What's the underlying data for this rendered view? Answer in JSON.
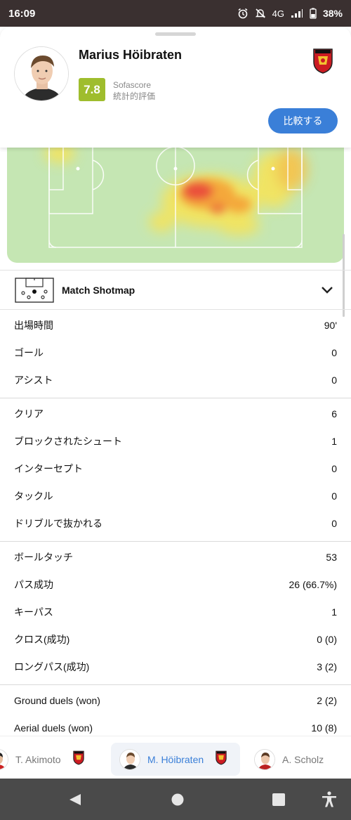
{
  "status_bar": {
    "time": "16:09",
    "network": "4G",
    "battery": "38%"
  },
  "header": {
    "player_name": "Marius Höibraten",
    "rating": "7.8",
    "rating_source": "Sofascore",
    "rating_subtitle": "統計的評価",
    "compare_button": "比較する"
  },
  "shotmap": {
    "title": "Match Shotmap"
  },
  "stat_groups": [
    [
      {
        "label": "出場時間",
        "value": "90'"
      },
      {
        "label": "ゴール",
        "value": "0"
      },
      {
        "label": "アシスト",
        "value": "0"
      }
    ],
    [
      {
        "label": "クリア",
        "value": "6"
      },
      {
        "label": "ブロックされたシュート",
        "value": "1"
      },
      {
        "label": "インターセプト",
        "value": "0"
      },
      {
        "label": "タックル",
        "value": "0"
      },
      {
        "label": "ドリブルで抜かれる",
        "value": "0"
      }
    ],
    [
      {
        "label": "ボールタッチ",
        "value": "53"
      },
      {
        "label": "パス成功",
        "value": "26 (66.7%)"
      },
      {
        "label": "キーパス",
        "value": "1"
      },
      {
        "label": "クロス(成功)",
        "value": "0 (0)"
      },
      {
        "label": "ロングパス(成功)",
        "value": "3 (2)"
      }
    ],
    [
      {
        "label": "Ground duels (won)",
        "value": "2 (2)"
      },
      {
        "label": "Aerial duels (won)",
        "value": "10 (8)"
      }
    ]
  ],
  "player_tabs": [
    {
      "name": "T. Akimoto",
      "active": false
    },
    {
      "name": "M. Höibraten",
      "active": true
    },
    {
      "name": "A. Scholz",
      "active": false
    }
  ],
  "colors": {
    "accent": "#3a7fd8",
    "rating": "#9fbd2d",
    "pitch": "#c5e6b3"
  },
  "icons": [
    "alarm-icon",
    "mute-icon",
    "signal-icon",
    "battery-icon",
    "club-badge",
    "chevron-down-icon",
    "back-icon",
    "home-icon",
    "recents-icon",
    "accessibility-icon"
  ]
}
